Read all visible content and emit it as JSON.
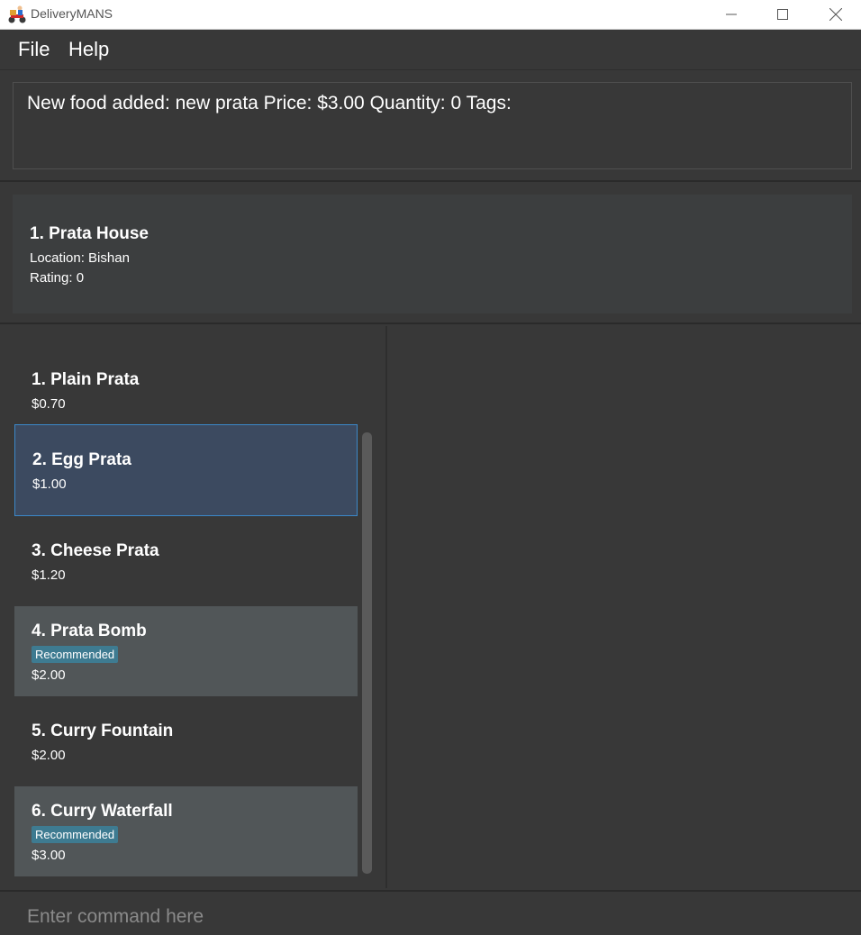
{
  "window": {
    "title": "DeliveryMANS",
    "app_icon": "delivery-scooter-icon"
  },
  "menu": {
    "items": [
      {
        "label": "File"
      },
      {
        "label": "Help"
      }
    ]
  },
  "result_display": {
    "text": "New food added: new prata Price: $3.00 Quantity: 0 Tags:"
  },
  "restaurant": {
    "title": "1.  Prata House",
    "location": "Location: Bishan",
    "rating": "Rating: 0"
  },
  "foods": [
    {
      "name": "1.  Plain Prata",
      "price": "$0.70"
    },
    {
      "name": "2.  Egg Prata",
      "price": "$1.00"
    },
    {
      "name": "3.  Cheese Prata",
      "price": "$1.20"
    },
    {
      "name": "4.  Prata Bomb",
      "tag": "Recommended",
      "price": "$2.00"
    },
    {
      "name": "5.  Curry Fountain",
      "price": "$2.00"
    },
    {
      "name": "6.  Curry Waterfall",
      "tag": "Recommended",
      "price": "$3.00"
    }
  ],
  "command_box": {
    "placeholder": "Enter command here",
    "value": ""
  },
  "colors": {
    "background": "#383838",
    "selected": "#3c4a60",
    "selected_border": "#3b88c9",
    "tag": "#3e7b91",
    "alt_card": "#515658"
  }
}
